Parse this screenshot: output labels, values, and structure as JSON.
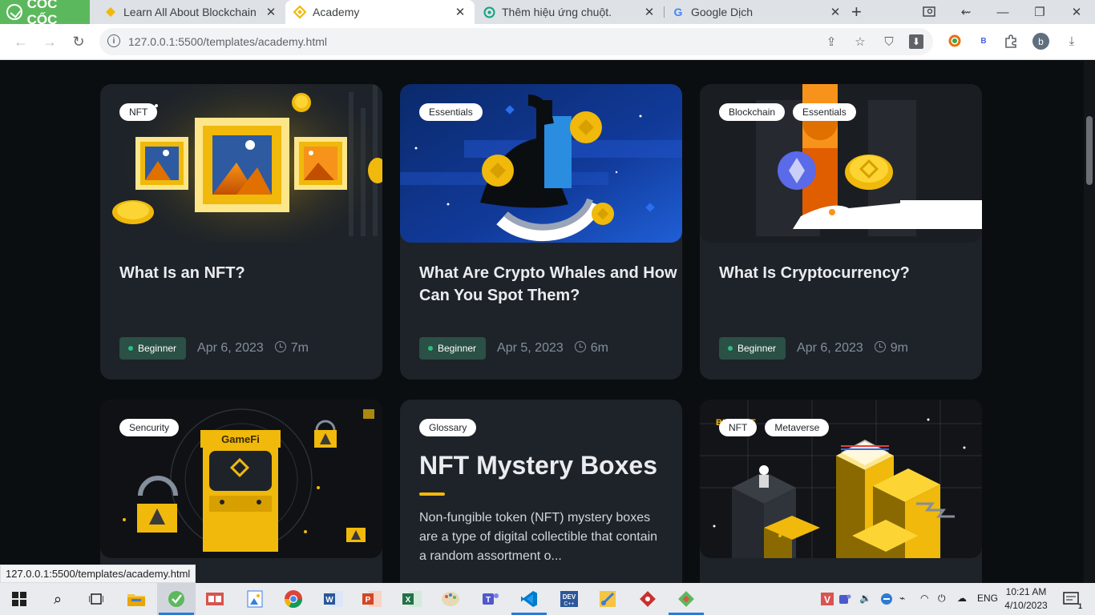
{
  "browser": {
    "brand_name": "CỐC CỐC",
    "tabs": [
      {
        "title": "Learn All About Blockchain & Cr",
        "favicon": "binance-icon"
      },
      {
        "title": "Academy",
        "favicon": "binance-icon",
        "active": true
      },
      {
        "title": "Thêm hiệu ứng chuột.",
        "favicon": "chatgpt-icon"
      },
      {
        "title": "Google Dịch",
        "favicon": "google-translate-icon"
      }
    ],
    "url": "127.0.0.1:5500/templates/academy.html",
    "profile_initial": "b",
    "extension_letter": "B",
    "status_url": "127.0.0.1:5500/templates/academy.html"
  },
  "cards": [
    {
      "tags": [
        "NFT"
      ],
      "title": "What Is an NFT?",
      "level": "Beginner",
      "date": "Apr 6, 2023",
      "duration": "7m"
    },
    {
      "tags": [
        "Essentials"
      ],
      "title": "What Are Crypto Whales and How Can You Spot Them?",
      "level": "Beginner",
      "date": "Apr 5, 2023",
      "duration": "6m"
    },
    {
      "tags": [
        "Blockchain",
        "Essentials"
      ],
      "title": "What Is Cryptocurrency?",
      "level": "Beginner",
      "date": "Apr 6, 2023",
      "duration": "9m"
    },
    {
      "tags": [
        "Sencurity"
      ],
      "art_text": "GameFi"
    },
    {
      "tags": [
        "Glossary"
      ],
      "title": "NFT Mystery Boxes",
      "description": "Non-fungible token (NFT) mystery boxes are a type of digital collectible that contain a random assortment o..."
    },
    {
      "tags": [
        "NFT",
        "Metaverse"
      ],
      "art_text": "BINANCE"
    }
  ],
  "taskbar": {
    "language": "ENG",
    "time": "10:21 AM",
    "date": "4/10/2023",
    "notification_count": "1"
  },
  "colors": {
    "page_bg": "#0b0e11",
    "card_bg": "#1e2329",
    "accent": "#f0b90b",
    "level_badge_bg": "#2b5046"
  }
}
